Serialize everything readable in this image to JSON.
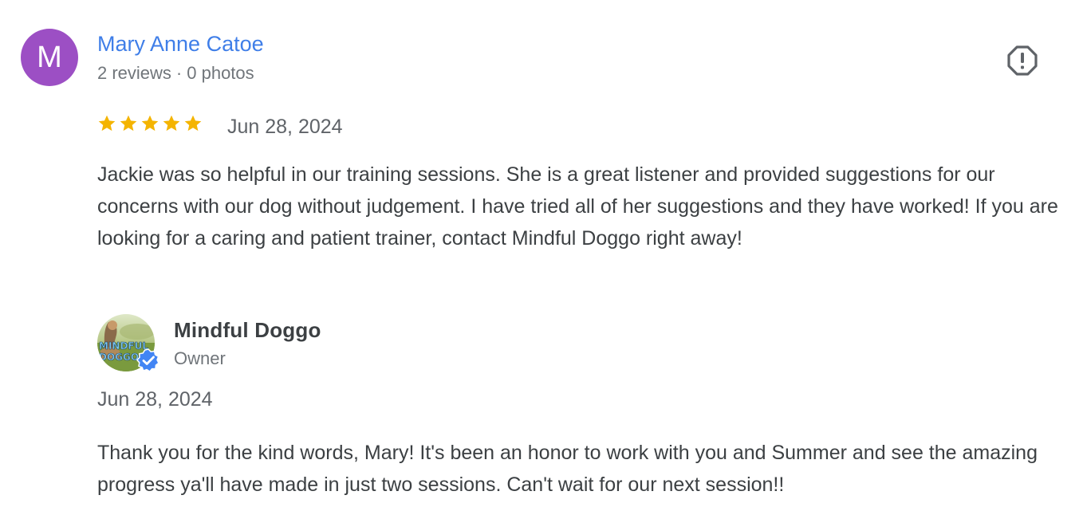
{
  "review": {
    "avatar_letter": "M",
    "avatar_color": "#9c4fc4",
    "reviewer_name": "Mary Anne Catoe",
    "reviews_count": "2 reviews",
    "separator": "·",
    "photos_count": "0 photos",
    "flag_icon": "report-flag-icon",
    "rating": 5,
    "rating_max": 5,
    "star_color": "#f4b400",
    "date": "Jun 28, 2024",
    "text": "Jackie was so helpful in our training sessions. She is a great listener and provided suggestions for our concerns with our dog without judgement. I have tried all of her suggestions and they have worked! If you are looking for a caring and patient trainer, contact Mindful Doggo right away!"
  },
  "owner_reply": {
    "name": "Mindful Doggo",
    "role": "Owner",
    "avatar_logo_text": "MINDFUL DOGGO",
    "verified_icon": "verified-check-icon",
    "date": "Jun 28, 2024",
    "text": "Thank you for the kind words, Mary! It's been an honor to work with you and Summer and see the amazing progress ya'll have made in just two sessions. Can't wait for our next session!!"
  },
  "colors": {
    "link_blue": "#3f7ee8",
    "verified_blue": "#4285f4",
    "muted_text": "#70757a"
  }
}
